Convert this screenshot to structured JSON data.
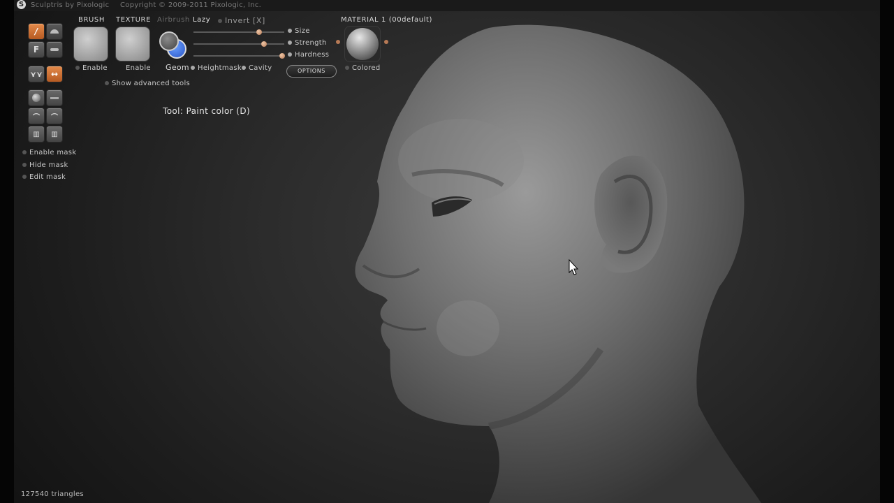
{
  "window": {
    "title": "Sculptris by Pixologic",
    "copyright": "Copyright © 2009-2011 Pixologic, Inc.",
    "logo_glyph": "S"
  },
  "toolbar": {
    "brush_header": "BRUSH",
    "texture_header": "TEXTURE",
    "airbrush_label": "Airbrush",
    "lazy_label": "Lazy",
    "invert_label": "Invert [X]",
    "brush_enable": "Enable",
    "texture_enable": "Enable",
    "geom_label": "Geom",
    "heightmask_label": "Heightmask",
    "cavity_label": "Cavity",
    "show_advanced": "Show advanced tools",
    "options_label": "OPTIONS"
  },
  "sliders": [
    {
      "label": "Size",
      "value": 0.72
    },
    {
      "label": "Strength",
      "value": 0.78
    },
    {
      "label": "Hardness",
      "value": 0.98
    }
  ],
  "material": {
    "header": "MATERIAL 1 (00default)",
    "colored_label": "Colored"
  },
  "mask": {
    "enable": "Enable mask",
    "hide": "Hide mask",
    "edit": "Edit mask"
  },
  "status": {
    "tool": "Tool: Paint color (D)",
    "triangles": "127540 triangles"
  },
  "tools": {
    "paint_glyph": "/",
    "flatten_glyph": "F",
    "arrows_glyph": "↔"
  },
  "colors": {
    "accent": "#d8793a",
    "geom_blue": "#3d6fd6"
  }
}
